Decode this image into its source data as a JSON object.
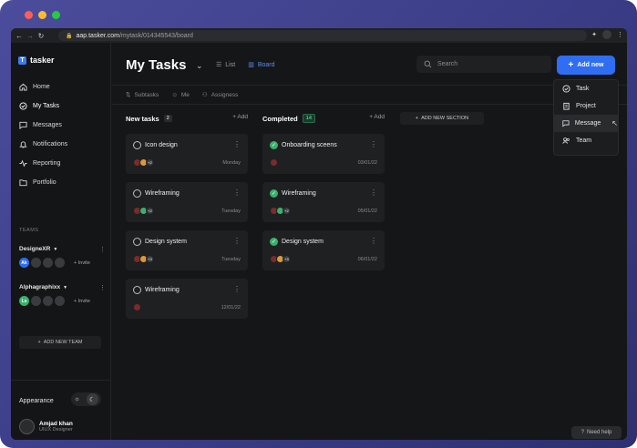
{
  "browser": {
    "url_host": "aap.tasker.com",
    "url_path": "/mytask/014345543/board"
  },
  "app": {
    "logo_text": "tasker",
    "logo_mark": "T",
    "nav": [
      {
        "label": "Home",
        "icon": "home-icon"
      },
      {
        "label": "My Tasks",
        "icon": "check-circle-icon"
      },
      {
        "label": "Messages",
        "icon": "message-icon"
      },
      {
        "label": "Notifications",
        "icon": "bell-icon"
      },
      {
        "label": "Reporting",
        "icon": "activity-icon"
      },
      {
        "label": "Portfolio",
        "icon": "folder-icon"
      }
    ],
    "teams_label": "TEAMS",
    "teams": [
      {
        "name": "DesigneXR",
        "lead_initials": "Ak",
        "lead_color": "#2f6ef2",
        "invite": "+ Invite"
      },
      {
        "name": "Alphagraphixx",
        "lead_initials": "Ls",
        "lead_color": "#3ab06c",
        "invite": "+ Invite"
      }
    ],
    "add_team": "ADD NEW TEAM",
    "appearance_label": "Appearance",
    "user": {
      "name": "Amjad khan",
      "role": "UIUX Designer"
    }
  },
  "header": {
    "title": "My Tasks",
    "views": [
      {
        "label": "List"
      },
      {
        "label": "Board"
      }
    ],
    "search_placeholder": "Search",
    "add_new": "Add new"
  },
  "toolbar": [
    "Subtasks",
    "Me",
    "Assigness"
  ],
  "columns": [
    {
      "title": "New tasks",
      "count": "2",
      "add": "+ Add",
      "cards": [
        {
          "title": "Icon design",
          "date": "Monday",
          "extra": "+2"
        },
        {
          "title": "Wireframing",
          "date": "Tuesday",
          "extra": "+2"
        },
        {
          "title": "Design system",
          "date": "Tuesday",
          "extra": "+3"
        },
        {
          "title": "Wireframing",
          "date": "12/01/22",
          "extra": ""
        }
      ]
    },
    {
      "title": "Completed",
      "count": "14",
      "add": "+ Add",
      "cards": [
        {
          "title": "Onboarding sceens",
          "date": "03/01/22",
          "extra": ""
        },
        {
          "title": "Wireframing",
          "date": "05/01/22",
          "extra": "+2"
        },
        {
          "title": "Design system",
          "date": "06/01/22",
          "extra": "+3"
        }
      ]
    }
  ],
  "add_section": "ADD NEW SECTION",
  "dropdown": [
    {
      "label": "Task",
      "icon": "check-circle-icon"
    },
    {
      "label": "Project",
      "icon": "clipboard-icon"
    },
    {
      "label": "Message",
      "icon": "message-icon"
    },
    {
      "label": "Team",
      "icon": "users-icon"
    }
  ],
  "help": "Need help",
  "colors": {
    "accent": "#2f6ef2",
    "success": "#3ab06c",
    "background": "#151617"
  }
}
